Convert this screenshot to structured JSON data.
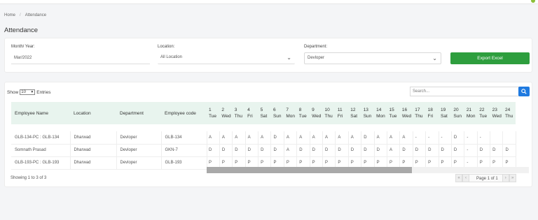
{
  "breadcrumb": {
    "home": "Home",
    "current": "Attendance"
  },
  "page_title": "Attendance",
  "filters": {
    "month_label": "Month/ Year:",
    "month_value": "Mar/2022",
    "location_label": "Location:",
    "location_value": "All Location",
    "department_label": "Department:",
    "department_value": "Devloper",
    "export_label": "Export Excel"
  },
  "table": {
    "show_prefix": "Show",
    "show_value": "10",
    "show_suffix": "Entries",
    "search_placeholder": "Search...",
    "headers": [
      "Employee Name",
      "Location",
      "Department",
      "Employee code"
    ],
    "rows": [
      [
        "GLB-134-PC : GLB-134",
        "Dharwad",
        "Devloper",
        "GLB-134"
      ],
      [
        "Somnath Prasad",
        "Dharwad",
        "Devloper",
        "GKN-7"
      ],
      [
        "GLB-193-PC : GLB-193",
        "Dharwad",
        "Devloper",
        "GLB-193"
      ]
    ],
    "days": [
      {
        "n": "1",
        "d": "Tue"
      },
      {
        "n": "2",
        "d": "Wed"
      },
      {
        "n": "3",
        "d": "Thu"
      },
      {
        "n": "4",
        "d": "Fri"
      },
      {
        "n": "5",
        "d": "Sat"
      },
      {
        "n": "6",
        "d": "Sun"
      },
      {
        "n": "7",
        "d": "Mon"
      },
      {
        "n": "8",
        "d": "Tue"
      },
      {
        "n": "9",
        "d": "Wed"
      },
      {
        "n": "10",
        "d": "Thu"
      },
      {
        "n": "11",
        "d": "Fri"
      },
      {
        "n": "12",
        "d": "Sat"
      },
      {
        "n": "13",
        "d": "Sun"
      },
      {
        "n": "14",
        "d": "Mon"
      },
      {
        "n": "15",
        "d": "Tue"
      },
      {
        "n": "16",
        "d": "Wed"
      },
      {
        "n": "17",
        "d": "Thu"
      },
      {
        "n": "18",
        "d": "Fri"
      },
      {
        "n": "19",
        "d": "Sat"
      },
      {
        "n": "20",
        "d": "Sun"
      },
      {
        "n": "21",
        "d": "Mon"
      },
      {
        "n": "22",
        "d": "Tue"
      },
      {
        "n": "23",
        "d": "Wed"
      },
      {
        "n": "24",
        "d": "Thu"
      }
    ],
    "attendance": [
      [
        "A",
        "A",
        "A",
        "A",
        "A",
        "D",
        "A",
        "A",
        "A",
        "A",
        "A",
        "A",
        "D",
        "A",
        "A",
        "A",
        "-",
        "-",
        "-",
        "D",
        "-",
        "-",
        "",
        ""
      ],
      [
        "D",
        "D",
        "D",
        "D",
        "D",
        "D",
        "A",
        "D",
        "D",
        "D",
        "D",
        "D",
        "D",
        "D",
        "A",
        "D",
        "D",
        "D",
        "D",
        "D",
        "-",
        "D",
        "D",
        "D"
      ],
      [
        "P",
        "P",
        "P",
        "P",
        "P",
        "P",
        "P",
        "P",
        "P",
        "P",
        "P",
        "P",
        "P",
        "P",
        "P",
        "P",
        "P",
        "P",
        "P",
        "P",
        "-",
        "P",
        "P",
        "P"
      ]
    ],
    "showing": "Showing 1 to 3 of 3",
    "page_label": "Page",
    "page_value": "1 of 1"
  }
}
